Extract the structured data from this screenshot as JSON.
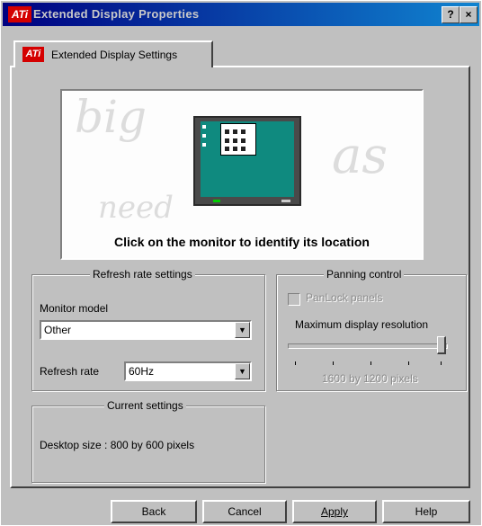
{
  "window": {
    "logo_text": "ATi",
    "title": "Extended Display Properties",
    "help_glyph": "?",
    "close_glyph": "×"
  },
  "tab": {
    "logo_text": "ATi",
    "label": "Extended Display Settings"
  },
  "preview": {
    "background_words": [
      "big",
      "as",
      "need"
    ],
    "instruction": "Click on the monitor to identify its location"
  },
  "refresh": {
    "title": "Refresh rate settings",
    "monitor_label": "Monitor model",
    "monitor_value": "Other",
    "rate_label": "Refresh rate",
    "rate_value": "60Hz"
  },
  "panning": {
    "title": "Panning control",
    "lock_label": "PanLock panels",
    "lock_checked": false,
    "max_label": "Maximum display resolution",
    "slider_value": "1600 by 1200 pixels",
    "slider_level": 1.0
  },
  "current": {
    "title": "Current settings",
    "desktop_size": "Desktop size :  800 by 600 pixels"
  },
  "buttons": {
    "back": "Back",
    "cancel": "Cancel",
    "apply": "Apply",
    "help": "Help"
  },
  "colors": {
    "title_bar": "#000080",
    "logo_red": "#d40000",
    "monitor_screen": "#0f8a7f"
  }
}
